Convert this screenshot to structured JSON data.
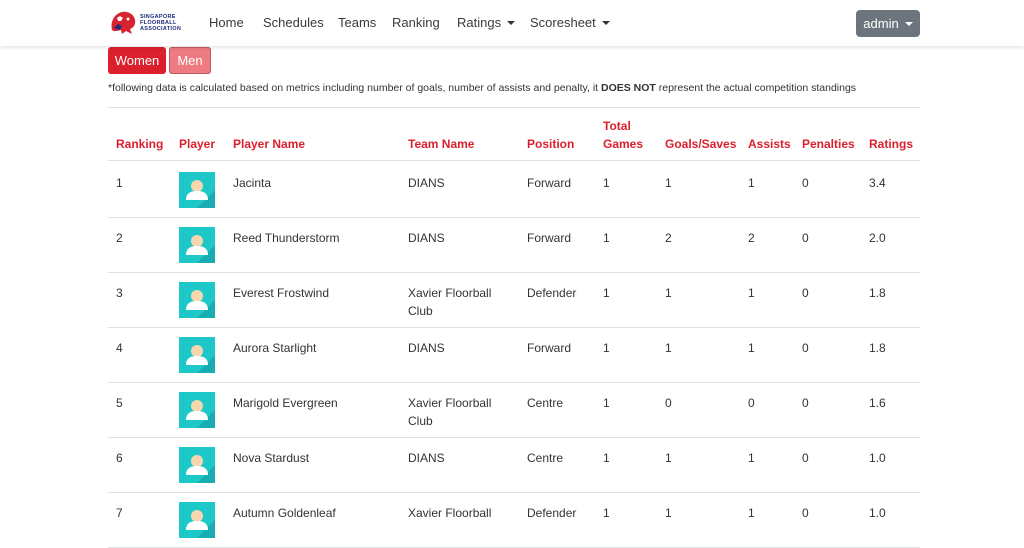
{
  "nav": {
    "logo_text": "SINGAPORE FLOORBALL ASSOCIATION",
    "items": [
      "Home",
      "Schedules",
      "Teams",
      "Ranking",
      "Ratings",
      "Scoresheet"
    ],
    "user": "admin"
  },
  "toggle": {
    "women": "Women",
    "men": "Men",
    "active": "Women"
  },
  "note": {
    "pre": "*following data is calculated based on metrics including number of goals, number of assists and penalty, it ",
    "bold": "DOES NOT",
    "post": " represent the actual competition standings"
  },
  "table": {
    "headers": {
      "ranking": "Ranking",
      "player": "Player",
      "player_name": "Player Name",
      "team_name": "Team Name",
      "position": "Position",
      "total_games_1": "Total",
      "total_games_2": "Games",
      "goals": "Goals/Saves",
      "assists": "Assists",
      "penalties": "Penalties",
      "ratings": "Ratings"
    },
    "rows": [
      {
        "rank": "1",
        "name": "Jacinta",
        "team": [
          "DIANS"
        ],
        "position": "Forward",
        "games": "1",
        "goals": "1",
        "assists": "1",
        "penalties": "0",
        "rating": "3.4"
      },
      {
        "rank": "2",
        "name": "Reed Thunderstorm",
        "team": [
          "DIANS"
        ],
        "position": "Forward",
        "games": "1",
        "goals": "2",
        "assists": "2",
        "penalties": "0",
        "rating": "2.0"
      },
      {
        "rank": "3",
        "name": "Everest Frostwind",
        "team": [
          "Xavier Floorball",
          "Club"
        ],
        "position": "Defender",
        "games": "1",
        "goals": "1",
        "assists": "1",
        "penalties": "0",
        "rating": "1.8"
      },
      {
        "rank": "4",
        "name": "Aurora Starlight",
        "team": [
          "DIANS"
        ],
        "position": "Forward",
        "games": "1",
        "goals": "1",
        "assists": "1",
        "penalties": "0",
        "rating": "1.8"
      },
      {
        "rank": "5",
        "name": "Marigold Evergreen",
        "team": [
          "Xavier Floorball",
          "Club"
        ],
        "position": "Centre",
        "games": "1",
        "goals": "0",
        "assists": "0",
        "penalties": "0",
        "rating": "1.6"
      },
      {
        "rank": "6",
        "name": "Nova Stardust",
        "team": [
          "DIANS"
        ],
        "position": "Centre",
        "games": "1",
        "goals": "1",
        "assists": "1",
        "penalties": "0",
        "rating": "1.0"
      },
      {
        "rank": "7",
        "name": "Autumn Goldenleaf",
        "team": [
          "Xavier Floorball"
        ],
        "position": "Defender",
        "games": "1",
        "goals": "1",
        "assists": "1",
        "penalties": "0",
        "rating": "1.0"
      }
    ]
  },
  "colors": {
    "accent": "#dc1f2d",
    "accent_light": "#ef7b82",
    "avatar_bg": "#1ec8c8",
    "admin_btn": "#6c757d"
  }
}
